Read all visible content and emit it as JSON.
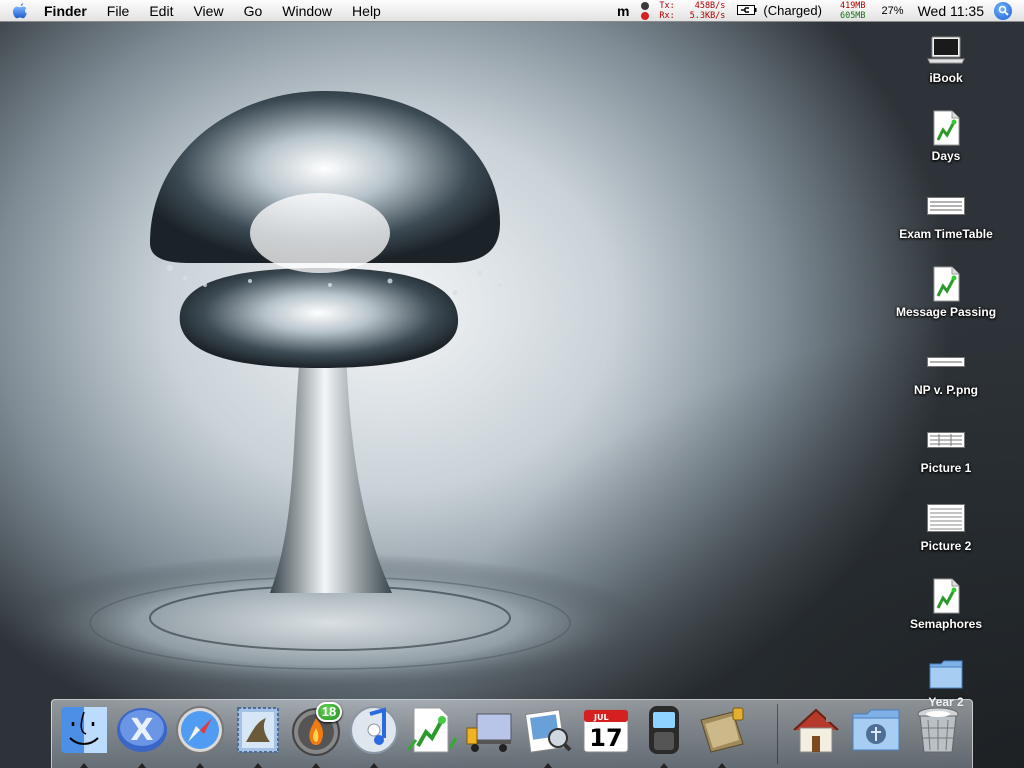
{
  "menubar": {
    "app_name": "Finder",
    "menus": [
      "File",
      "Edit",
      "View",
      "Go",
      "Window",
      "Help"
    ],
    "status": {
      "m_glyph": "m",
      "net_tx_label": "Tx:",
      "net_tx_value": "458B/s",
      "net_rx_label": "Rx:",
      "net_rx_value": "5.3KB/s",
      "battery": "(Charged)",
      "mem_top": "419MB",
      "mem_bottom": "605MB",
      "cpu": "27%",
      "clock": "Wed 11:35"
    }
  },
  "desktop_icons": [
    {
      "label": "iBook",
      "icon": "laptop-icon"
    },
    {
      "label": "Days",
      "icon": "document-icon"
    },
    {
      "label": "Exam TimeTable",
      "icon": "image-thumbnail-icon"
    },
    {
      "label": "Message Passing",
      "icon": "document-icon"
    },
    {
      "label": "NP v. P.png",
      "icon": "image-thumbnail-icon"
    },
    {
      "label": "Picture 1",
      "icon": "image-thumbnail-icon"
    },
    {
      "label": "Picture 2",
      "icon": "image-thumbnail-icon"
    },
    {
      "label": "Semaphores",
      "icon": "document-icon"
    },
    {
      "label": "Year 2",
      "icon": "folder-icon"
    }
  ],
  "dock": {
    "items": [
      {
        "name": "finder",
        "icon": "finder-icon",
        "running": true
      },
      {
        "name": "x-app",
        "icon": "x-icon",
        "running": true
      },
      {
        "name": "safari",
        "icon": "safari-compass-icon",
        "running": true
      },
      {
        "name": "mail",
        "icon": "mail-stamp-icon",
        "running": true
      },
      {
        "name": "fire",
        "icon": "fire-icon",
        "running": true,
        "badge": "18"
      },
      {
        "name": "itunes",
        "icon": "itunes-icon",
        "running": true
      },
      {
        "name": "omnigraffle",
        "icon": "document-chart-icon",
        "running": false
      },
      {
        "name": "transmit",
        "icon": "truck-icon",
        "running": false
      },
      {
        "name": "preview",
        "icon": "preview-icon",
        "running": true
      },
      {
        "name": "ical",
        "icon": "calendar-icon",
        "running": false,
        "calendar_month": "JUL",
        "calendar_day": "17"
      },
      {
        "name": "phone",
        "icon": "phone-icon",
        "running": true
      },
      {
        "name": "notebook",
        "icon": "notebook-icon",
        "running": true
      }
    ],
    "trailing": [
      {
        "name": "home",
        "icon": "home-icon"
      },
      {
        "name": "applications",
        "icon": "applications-folder-icon"
      },
      {
        "name": "trash",
        "icon": "trash-icon"
      }
    ]
  },
  "colors": {
    "menubar_top": "#fdfdfd",
    "net_text": "#b00000",
    "mem_second": "#167016",
    "spotlight": "#1d5fd1",
    "badge": "#1f8f1a"
  }
}
